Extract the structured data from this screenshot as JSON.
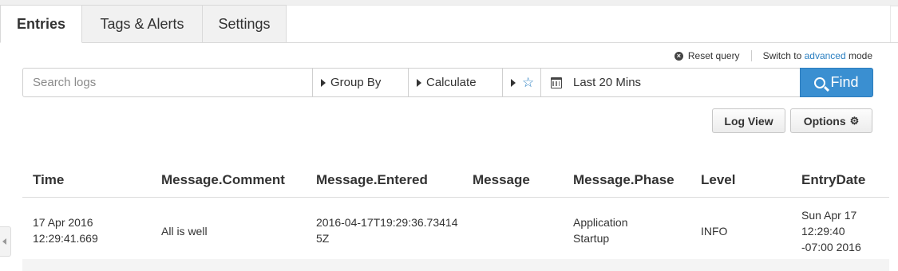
{
  "tabs": [
    {
      "label": "Entries",
      "active": true
    },
    {
      "label": "Tags & Alerts",
      "active": false
    },
    {
      "label": "Settings",
      "active": false
    }
  ],
  "query_links": {
    "reset": "Reset query",
    "switch_prefix": "Switch to ",
    "switch_link": "advanced",
    "switch_suffix": " mode"
  },
  "search": {
    "placeholder": "Search logs",
    "group_by": "Group By",
    "calculate": "Calculate",
    "time_range": "Last 20 Mins",
    "find_label": "Find"
  },
  "toolbar": {
    "log_view": "Log View",
    "options": "Options"
  },
  "table": {
    "headers": [
      "Time",
      "Message.Comment",
      "Message.Entered",
      "Message",
      "Message.Phase",
      "Level",
      "EntryDate"
    ],
    "rows": [
      {
        "time": "17 Apr 2016 12:29:41.669",
        "comment": "All is well",
        "entered": "2016-04-17T19:29:36.734145Z",
        "message": "",
        "phase": "Application Startup",
        "level": "INFO",
        "entry_date": "Sun Apr 17 12:29:40 -07:00 2016"
      }
    ]
  },
  "colors": {
    "accent": "#3a8fd1",
    "link": "#2a7fc1"
  }
}
